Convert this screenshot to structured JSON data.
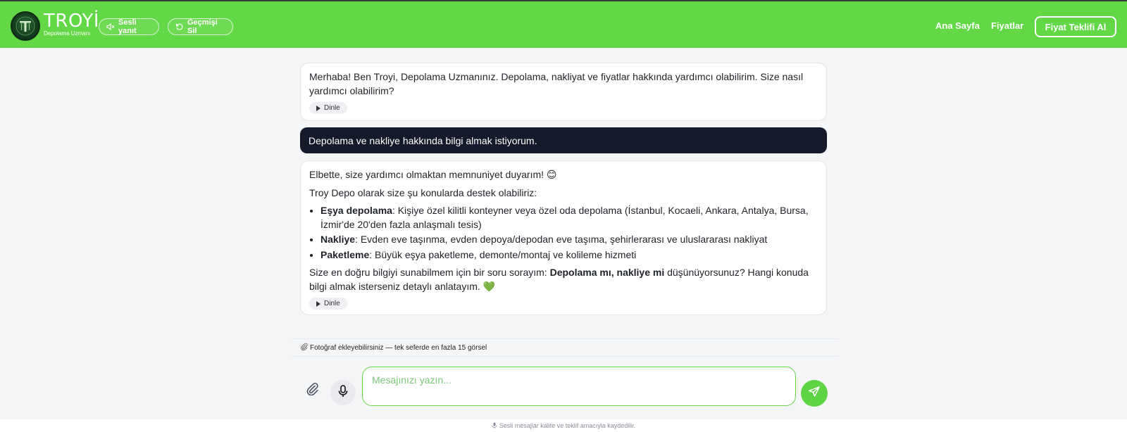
{
  "header": {
    "brand_name": "TROYİ",
    "brand_sub": "Depolama Uzmanı",
    "tts_toggle": "Sesli yanıt",
    "clear_history": "Geçmişi Sil",
    "nav_home": "Ana Sayfa",
    "nav_prices": "Fiyatlar",
    "quote_button": "Fiyat Teklifi Al",
    "accent_color": "#63d846"
  },
  "messages": [
    {
      "role": "bot",
      "text": "Merhaba! Ben Troyi, Depolama Uzmanınız. Depolama, nakliyat ve fiyatlar hakkında yardımcı olabilirim. Size nasıl yardımcı olabilirim?",
      "listen_label": "Dinle"
    },
    {
      "role": "user",
      "text": "Depolama ve nakliye hakkında bilgi almak istiyorum."
    },
    {
      "role": "bot",
      "intro": "Elbette, size yardımcı olmaktan memnuniyet duyarım! 😊",
      "lead": "Troy Depo olarak size şu konularda destek olabiliriz:",
      "items": [
        {
          "title": "Eşya depolama",
          "text": ": Kişiye özel kilitli konteyner veya özel oda depolama (İstanbul, Kocaeli, Ankara, Antalya, Bursa, İzmir'de 20'den fazla anlaşmalı tesis)"
        },
        {
          "title": "Nakliye",
          "text": ": Evden eve taşınma, evden depoya/depodan eve taşıma, şehirlerarası ve uluslararası nakliyat"
        },
        {
          "title": "Paketleme",
          "text": ": Büyük eşya paketleme, demonte/montaj ve kolileme hizmeti"
        }
      ],
      "closing_before": "Size en doğru bilgiyi sunabilmem için bir soru sorayım: ",
      "closing_bold": "Depolama mı, nakliye mi",
      "closing_after": " düşünüyorsunuz? Hangi konuda bilgi almak isterseniz detaylı anlatayım. 💚",
      "listen_label": "Dinle"
    }
  ],
  "composer": {
    "photo_hint": "Fotoğraf ekleyebilirsiniz — tek seferde en fazla 15 görsel",
    "placeholder": "Mesajınızı yazın...",
    "value": ""
  },
  "footer": {
    "note": "Sesli mesajlar kalite ve teklif amacıyla kaydedilir."
  }
}
